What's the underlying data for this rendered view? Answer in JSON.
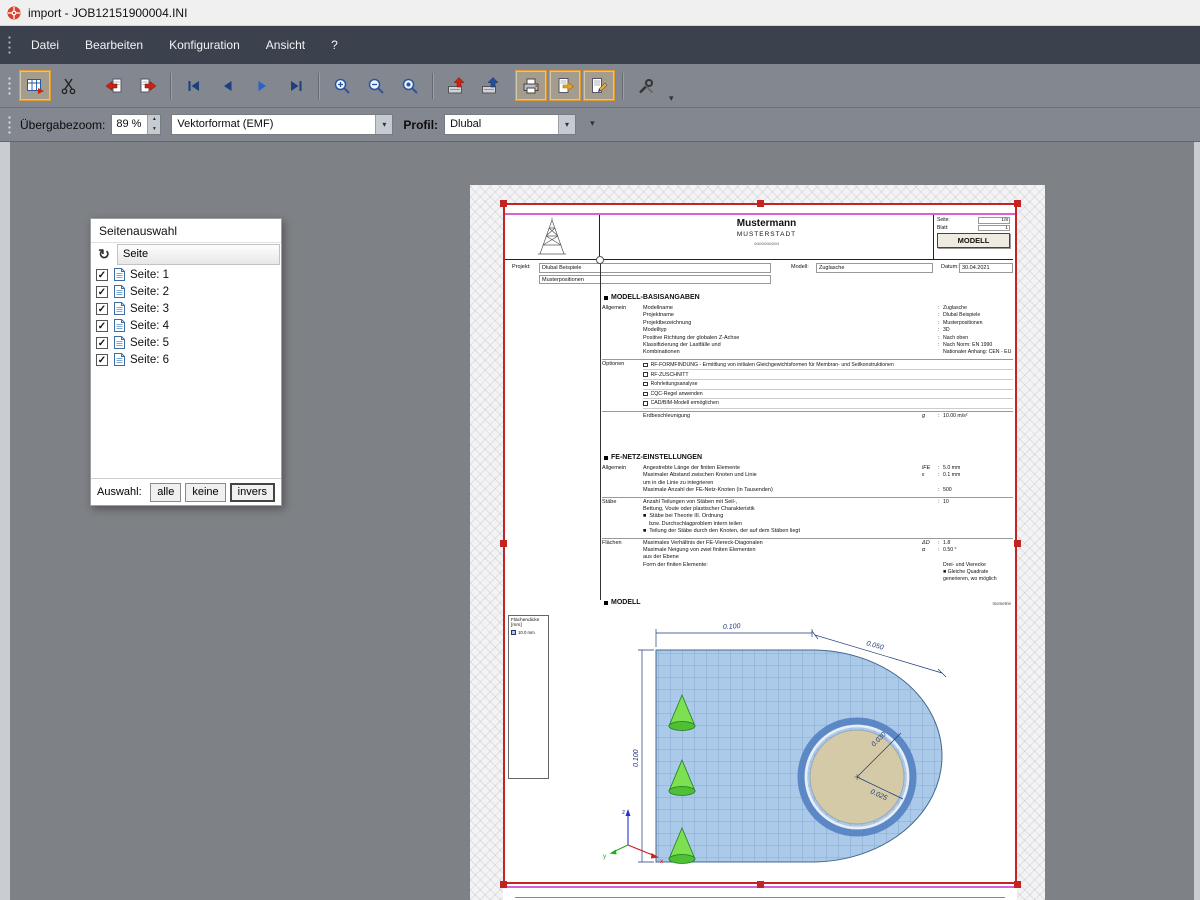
{
  "window": {
    "title": "import - JOB12151900004.INI"
  },
  "menu": {
    "items": [
      {
        "label": "Datei"
      },
      {
        "label": "Bearbeiten"
      },
      {
        "label": "Konfiguration"
      },
      {
        "label": "Ansicht"
      },
      {
        "label": "?"
      }
    ]
  },
  "options_bar": {
    "zoom_label": "Übergabezoom:",
    "zoom_value": "89 %",
    "format_value": "Vektorformat (EMF)",
    "profile_label": "Profil:",
    "profile_value": "Dlubal"
  },
  "page_dialog": {
    "title": "Seitenauswahl",
    "column_header": "Seite",
    "pages": [
      {
        "label": "Seite: 1",
        "checked": "✓"
      },
      {
        "label": "Seite: 2",
        "checked": "✓"
      },
      {
        "label": "Seite: 3",
        "checked": "✓"
      },
      {
        "label": "Seite: 4",
        "checked": "✓"
      },
      {
        "label": "Seite: 5",
        "checked": "✓"
      },
      {
        "label": "Seite: 6",
        "checked": "✓"
      }
    ],
    "footer_label": "Auswahl:",
    "button_all": "alle",
    "button_none": "keine",
    "button_invert": "invers"
  },
  "doc": {
    "header": {
      "name": "Mustermann",
      "city": "MUSTERSTADT",
      "placeholder": "oooooooooo",
      "page_label": "Seite:",
      "page_value": "1/8",
      "sheet_label": "Blatt:",
      "sheet_value": "1",
      "model_tab": "MODELL"
    },
    "meta": {
      "project_label": "Projekt:",
      "project_value": "Dlubal Beispiele",
      "project_sub": "Musterpositionen",
      "model_label": "Modell:",
      "model_value": "Zuglasche",
      "date_label": "Datum:",
      "date_value": "30.04.2021"
    },
    "basis": {
      "title": "MODELL-BASISANGABEN",
      "allgemein_label": "Allgemein",
      "allgemein_rows": [
        {
          "label": "Modellname",
          "colon": ":",
          "value": "Zuglasche"
        },
        {
          "label": "Projektname",
          "colon": ":",
          "value": "Dlubal Beispiele"
        },
        {
          "label": "Projektbezeichnung",
          "colon": ":",
          "value": "Musterpositionen"
        },
        {
          "label": "Modelltyp",
          "colon": ":",
          "value": "3D"
        },
        {
          "label": "Positive Richtung der globalen Z-Achse",
          "colon": ":",
          "value": "Nach oben"
        },
        {
          "label": "Klassifizierung der Lastfälle und",
          "colon": ":",
          "value": "Nach Norm: EN 1990"
        },
        {
          "label": "Kombinationen",
          "colon": "",
          "value": "Nationaler Anhang: CEN - EU"
        }
      ],
      "optionen_label": "Optionen",
      "optionen_rows": [
        {
          "label": "RF-FORMFINDUNG - Ermittlung von initialen Gleichgewichtsformen für Membran- und Seilkonstruktionen"
        },
        {
          "label": "RF-ZUSCHNITT"
        },
        {
          "label": "Rohrleitungsanalyse"
        },
        {
          "label": "CQC-Regel anwenden"
        },
        {
          "label": "CAD/BIM-Modell ermöglichen"
        }
      ],
      "gravity_label": "Erdbeschleunigung",
      "gravity_sym": "g",
      "gravity_colon": ":",
      "gravity_value": "10.00 m/s²"
    },
    "fenetz": {
      "title": "FE-NETZ-EINSTELLUNGEN",
      "g1_label": "Allgemein",
      "g1_rows": [
        {
          "label": "Angestrebte Länge der finiten Elemente",
          "sym": "lFE",
          "colon": ":",
          "value": "5.0 mm"
        },
        {
          "label": "Maximaler Abstand zwischen Knoten und Linie",
          "sym": "ε",
          "colon": ":",
          "value": "0.1 mm"
        },
        {
          "label": "um in die Linie zu integrieren"
        },
        {
          "label": "Maximale Anzahl der FE-Netz-Knoten (in Tausenden)",
          "colon": ":",
          "value": "500"
        }
      ],
      "g2_label": "Stäbe",
      "g2_rows": [
        {
          "label": "Anzahl Teilungen von Stäben mit Seil-,",
          "colon": ":",
          "value": "10"
        },
        {
          "label": "Bettung, Voute oder plastischer Charakteristik"
        },
        {
          "label": "■  Stäbe bei Theorie III. Ordnung"
        },
        {
          "label": "    bzw. Durchschlagproblem intern teilen"
        },
        {
          "label": "■  Teilung der Stäbe durch den Knoten, der auf dem Stäben liegt"
        }
      ],
      "g3_label": "Flächen",
      "g3_rows": [
        {
          "label": "Maximales Verhältnis der FE-Viereck-Diagonalen",
          "sym": "ΔD",
          "colon": ":",
          "value": "1.8"
        },
        {
          "label": "Maximale Neigung von zwei finiten Elementen",
          "sym": "α",
          "colon": ":",
          "value": "0.50 °"
        },
        {
          "label": "aus der Ebene"
        },
        {
          "label": "Form der finiten Elemente:",
          "colon": "",
          "value": "Drei- und Vierecke"
        },
        {
          "label": "",
          "colon": "",
          "value": "■ Gleiche Quadrate generieren, wo möglich"
        }
      ]
    },
    "modell": {
      "title": "MODELL",
      "corner": "Isometrie"
    },
    "legend": {
      "title": "Flächendicke",
      "unit": "[mm]",
      "entry": "10.0 mm"
    },
    "drawing": {
      "dim_top": "0.100",
      "dim_arc": "0.050",
      "dim_left": "0.100",
      "dim_radius_outer": "0.030",
      "dim_radius_inner": "0.025",
      "axis_x": "x",
      "axis_y": "y",
      "axis_z": "z"
    }
  },
  "icons": {
    "refresh-icon": "↻",
    "chevron-down-icon": "▾",
    "spin-up-icon": "▲",
    "spin-down-icon": "▼",
    "toolbar_icon_names": [
      "import-pages",
      "cut-scissors",
      "page-back",
      "page-forward",
      "nav-first",
      "nav-prev",
      "nav-next",
      "nav-last",
      "zoom-in",
      "zoom-out",
      "zoom-original",
      "send-to-program-red",
      "send-to-program-blue",
      "printer",
      "export-page",
      "edit-page",
      "tools-wrench"
    ]
  },
  "colors": {
    "selection_red": "#c22323",
    "guide_magenta": "#d95fd9",
    "accent_orange": "#e09a2f",
    "mesh_blue": "#abc9e8",
    "hole_tan": "#d5caa8",
    "support_green": "#63d23d"
  }
}
